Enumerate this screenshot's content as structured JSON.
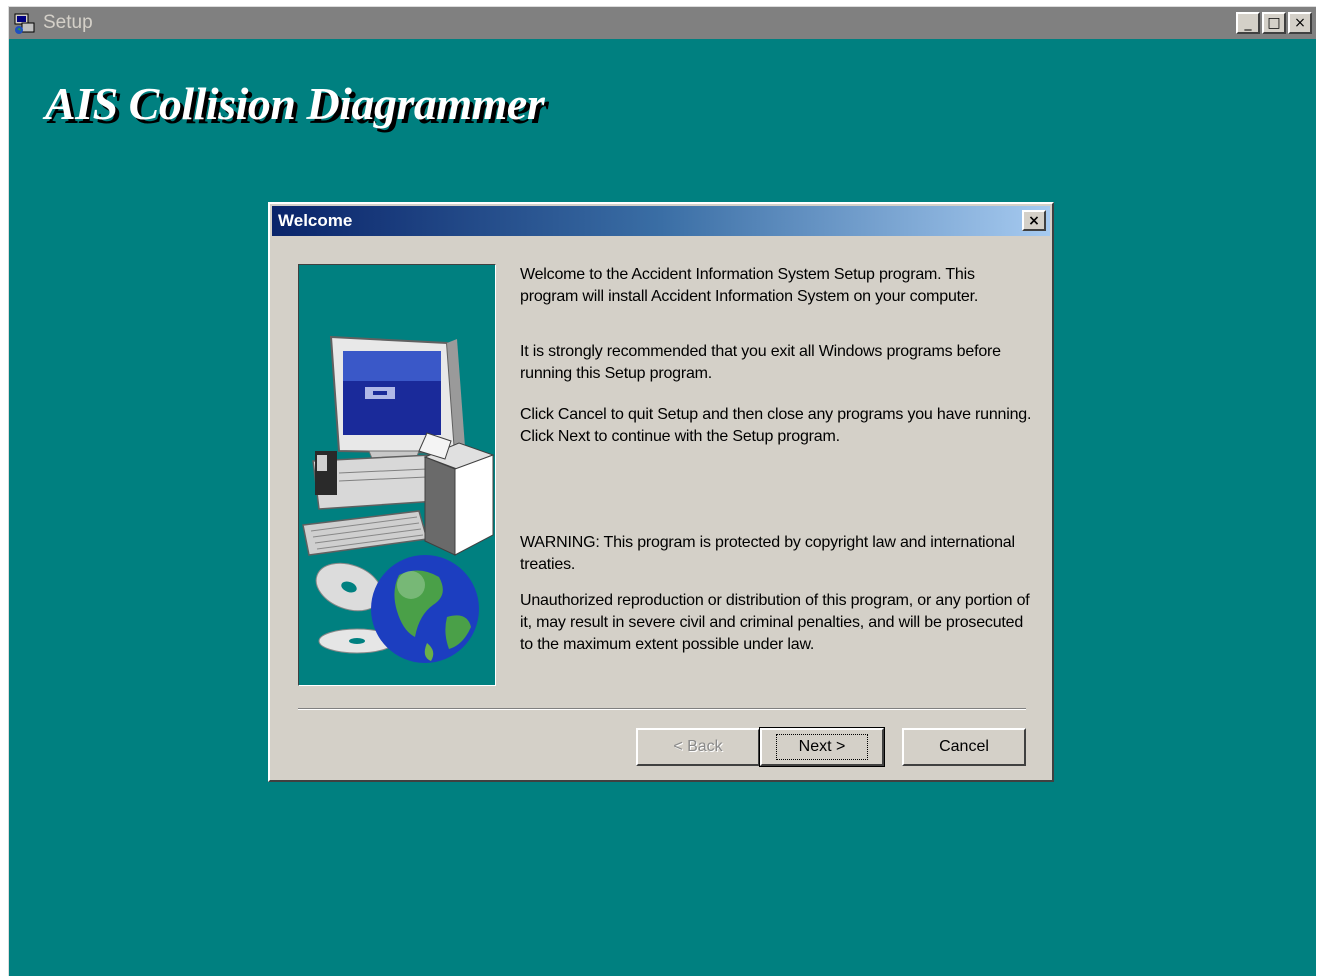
{
  "outer_window": {
    "title": "Setup",
    "controls": [
      "_",
      "□",
      "×"
    ]
  },
  "app_title": "AIS Collision Diagrammer",
  "dialog": {
    "title": "Welcome",
    "close_label": "×",
    "paragraphs": [
      "Welcome to the Accident Information System Setup program. This program will install Accident Information System on your computer.",
      "It is strongly recommended that you exit all Windows programs before running this Setup program.",
      "Click Cancel to quit Setup and then close any programs you have running.  Click Next to continue with the Setup program.",
      "WARNING: This program is protected by copyright law and international treaties.",
      "Unauthorized reproduction or distribution of this program, or any portion of it, may result in severe civil and criminal penalties, and will be prosecuted to the maximum extent possible under law."
    ],
    "buttons": {
      "back": "< Back",
      "next": "Next >",
      "cancel": "Cancel"
    }
  },
  "colors": {
    "desktop_teal": "#008080",
    "dialog_gray": "#d4d0c8",
    "title_gradient_start": "#0a246a",
    "title_gradient_end": "#a6caf0"
  }
}
